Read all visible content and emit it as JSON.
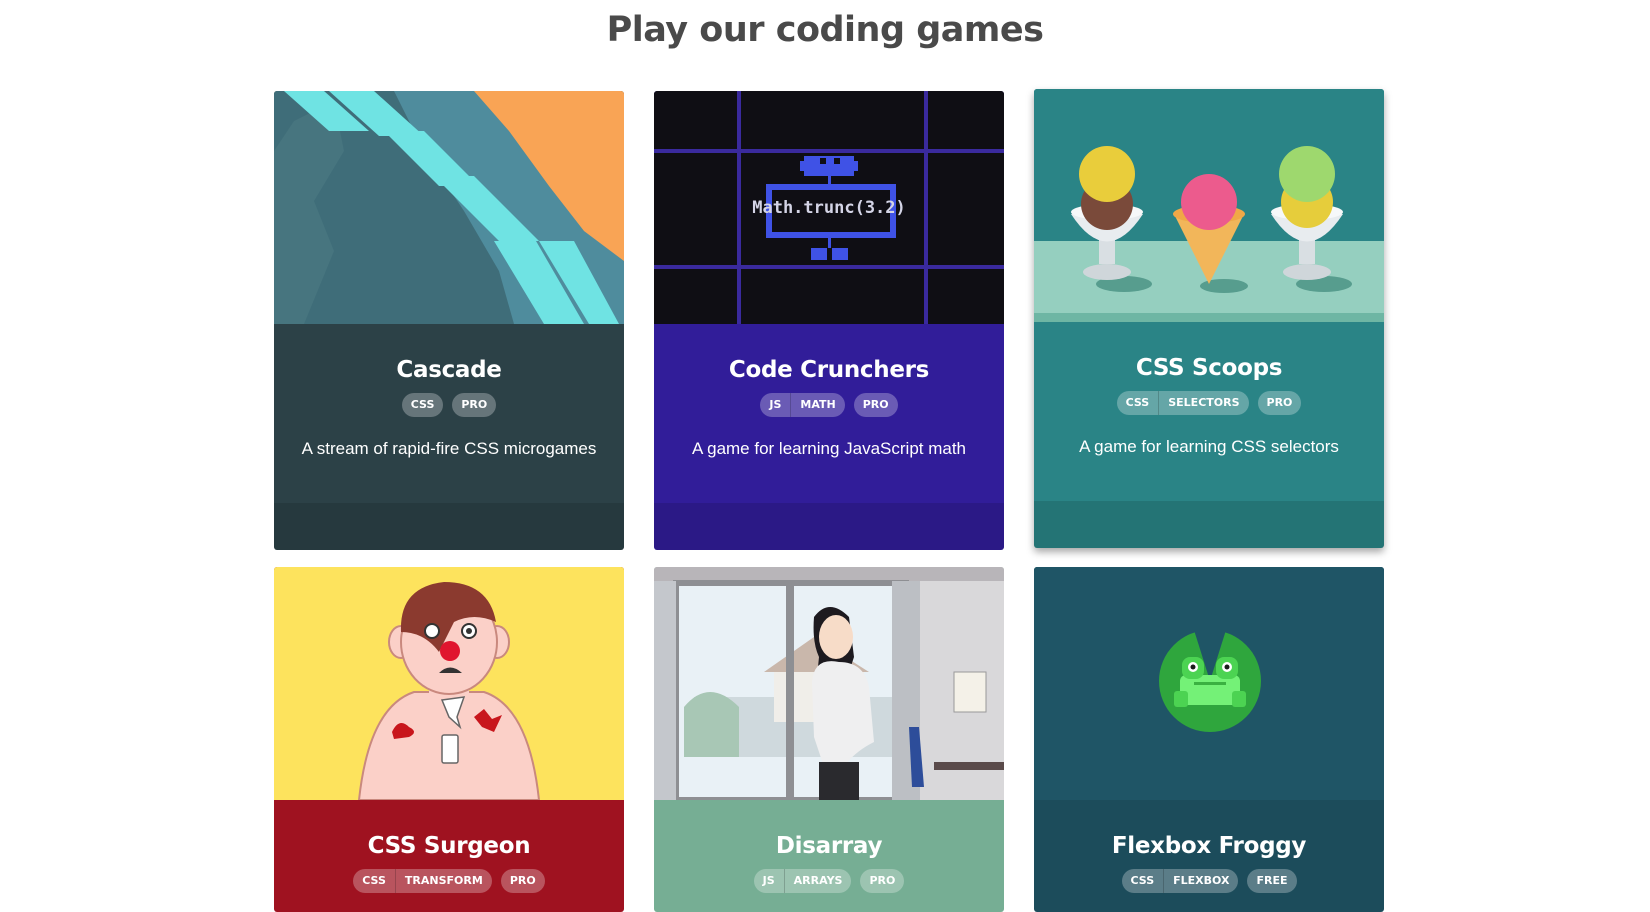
{
  "page_title": "Play our coding games",
  "games": [
    {
      "name": "Cascade",
      "tags": [
        [
          "CSS"
        ],
        [
          "PRO"
        ]
      ],
      "description": "A stream of rapid-fire CSS microgames",
      "color": "#2c4147"
    },
    {
      "name": "Code Crunchers",
      "tags": [
        [
          "JS",
          "MATH"
        ],
        [
          "PRO"
        ]
      ],
      "description": "A game for learning JavaScript math",
      "color": "#311d99",
      "art_text": "Math.trunc(3.2)"
    },
    {
      "name": "CSS Scoops",
      "tags": [
        [
          "CSS",
          "SELECTORS"
        ],
        [
          "PRO"
        ]
      ],
      "description": "A game for learning CSS selectors",
      "color": "#2a8486"
    },
    {
      "name": "CSS Surgeon",
      "tags": [
        [
          "CSS",
          "TRANSFORM"
        ],
        [
          "PRO"
        ]
      ],
      "color": "#9f1220"
    },
    {
      "name": "Disarray",
      "tags": [
        [
          "JS",
          "ARRAYS"
        ],
        [
          "PRO"
        ]
      ],
      "color": "#76ae94"
    },
    {
      "name": "Flexbox Froggy",
      "tags": [
        [
          "CSS",
          "FLEXBOX"
        ],
        [
          "FREE"
        ]
      ],
      "color": "#1c4c5b"
    }
  ]
}
